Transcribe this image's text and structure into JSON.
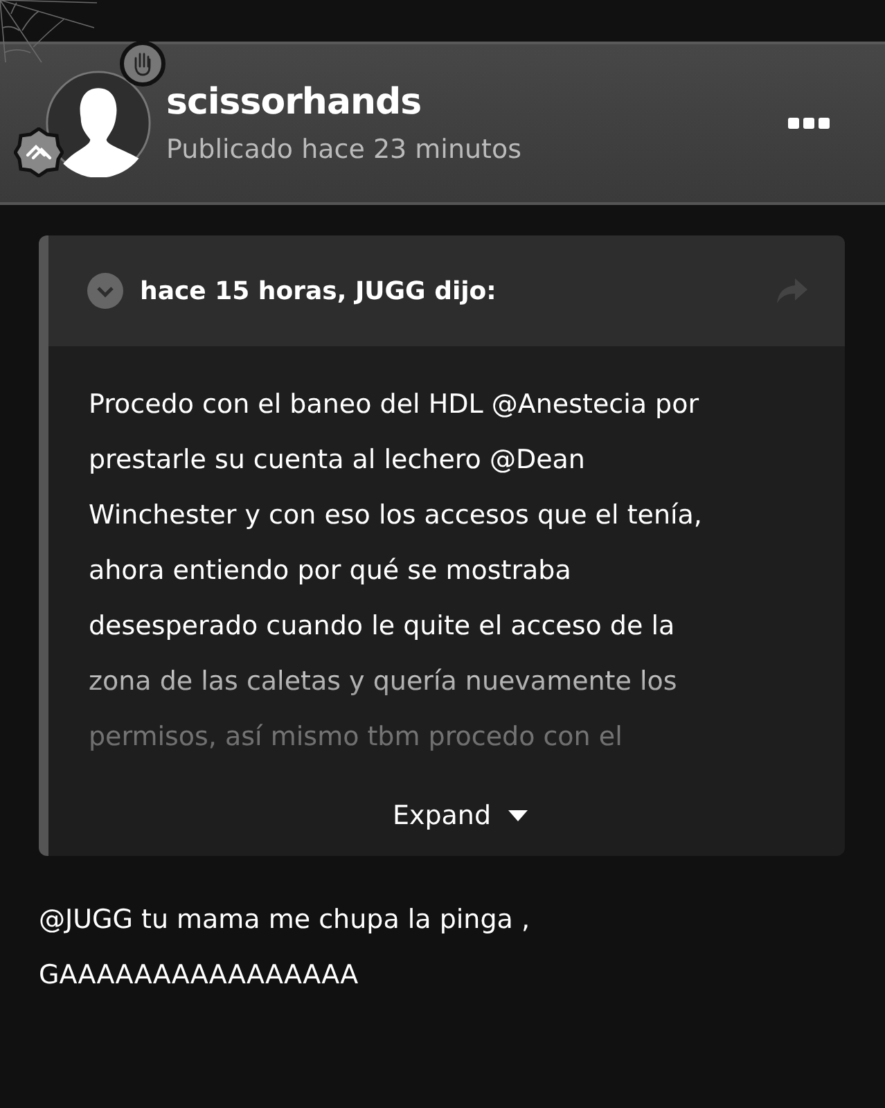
{
  "post": {
    "author": "scissorhands",
    "meta": "Publicado hace 23 minutos"
  },
  "quote": {
    "header": "hace 15 horas, JUGG dijo:",
    "text": "Procedo con el baneo del HDL @Anestecia por\nprestarle su cuenta al lechero @Dean\nWinchester y con eso los accesos que el tenía,\nahora entiendo por qué se mostraba\ndesesperado cuando le quite el acceso de la\nzona de las caletas y quería nuevamente los\npermisos, así mismo tbm procedo con el",
    "expand": "Expand"
  },
  "reply": "@JUGG tu mama me chupa la pinga ,\nGAAAAAAAAAAAAAAAA"
}
